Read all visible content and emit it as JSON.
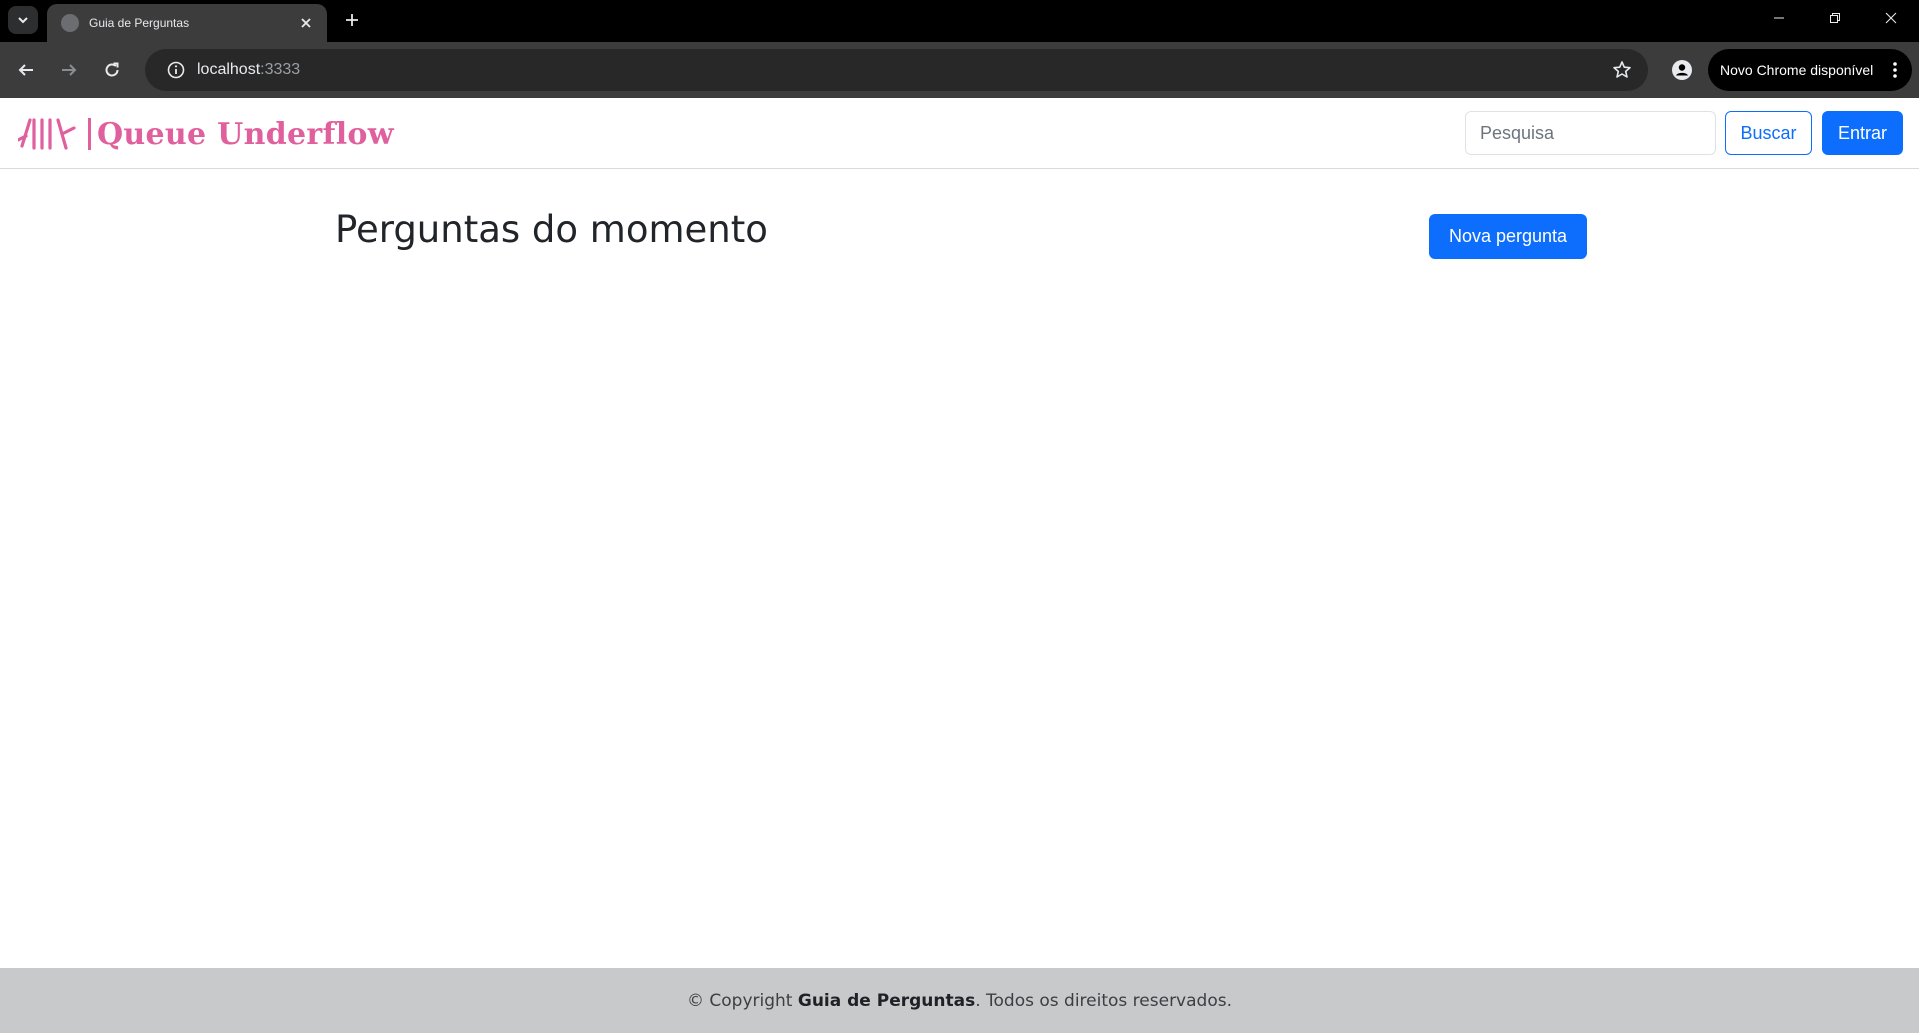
{
  "browser": {
    "tab": {
      "title": "Guia de Perguntas"
    },
    "url": {
      "host": "localhost",
      "port": ":3333"
    },
    "update_label": "Novo Chrome disponível"
  },
  "navbar": {
    "brand": "Queue Underflow",
    "search_placeholder": "Pesquisa",
    "search_button": "Buscar",
    "login_button": "Entrar",
    "brand_color": "#e0609e",
    "primary_color": "#0d6efd"
  },
  "main": {
    "title": "Perguntas do momento",
    "new_question_button": "Nova pergunta"
  },
  "footer": {
    "prefix": "© Copyright ",
    "brand": "Guia de Perguntas",
    "suffix": ". Todos os direitos reservados."
  }
}
